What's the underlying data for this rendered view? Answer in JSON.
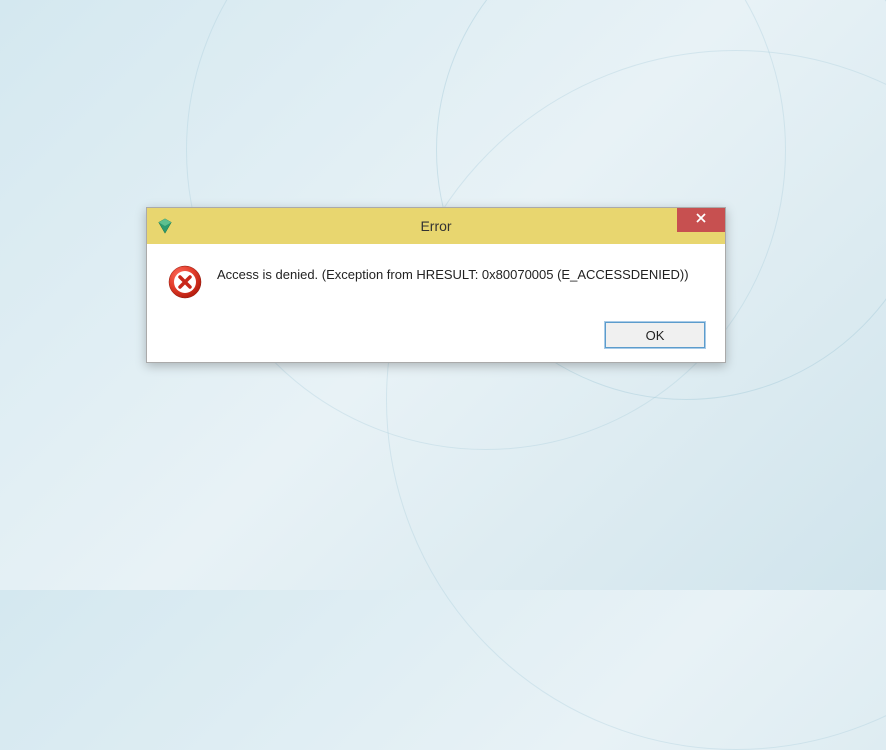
{
  "dialog": {
    "title": "Error",
    "message": "Access is denied. (Exception from HRESULT: 0x80070005 (E_ACCESSDENIED))",
    "ok_label": "OK"
  }
}
